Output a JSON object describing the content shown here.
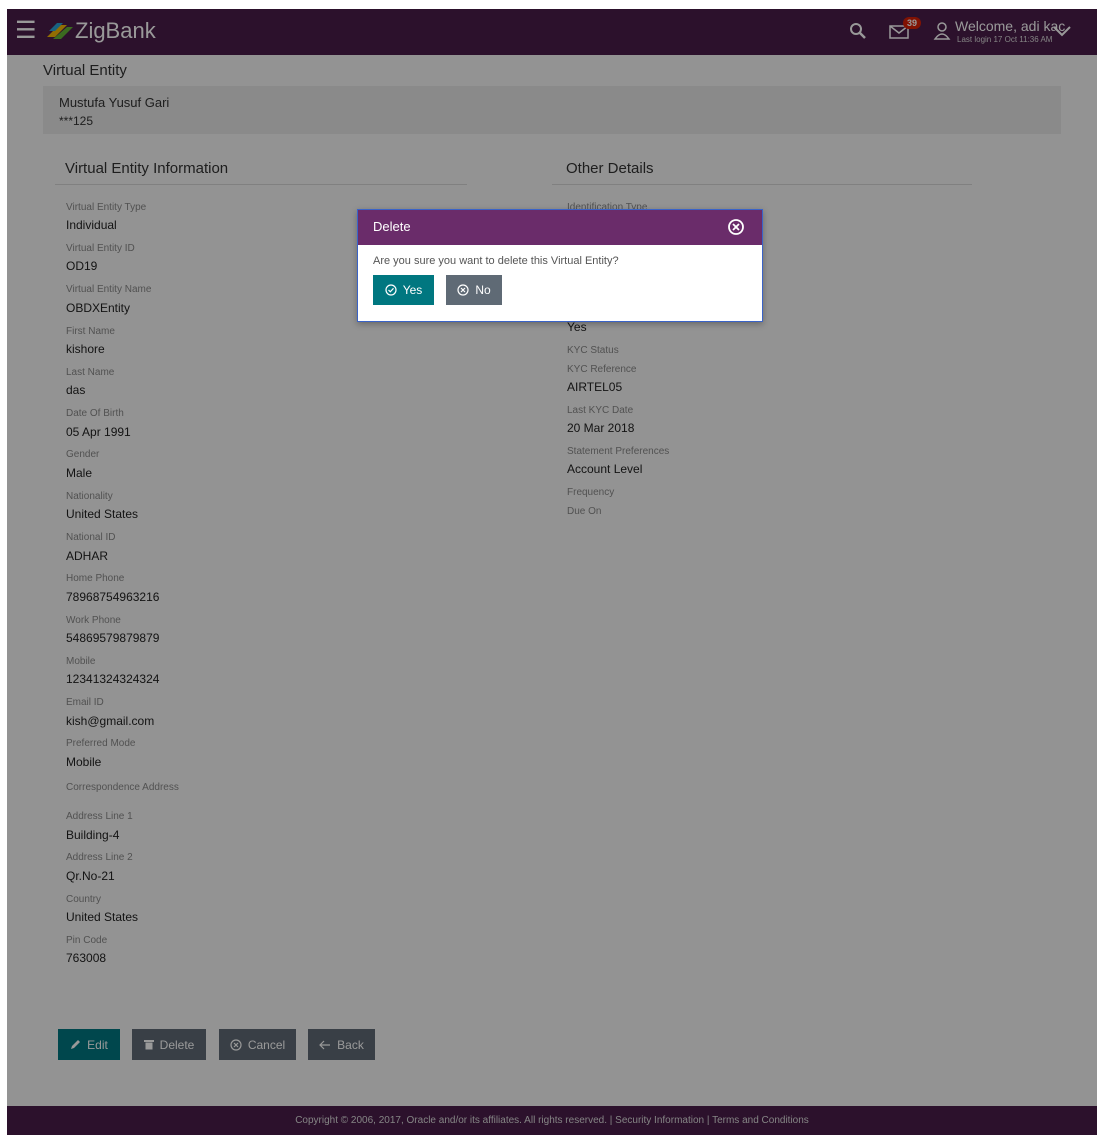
{
  "header": {
    "brand": "ZigBank",
    "notification_count": "39",
    "welcome": "Welcome, adi kac",
    "last_login": "Last login 17 Oct 11:36 AM"
  },
  "page": {
    "title": "Virtual Entity"
  },
  "party": {
    "name": "Mustufa Yusuf Gari",
    "id": "***125"
  },
  "left_section": {
    "title": "Virtual Entity Information",
    "fields": [
      {
        "label": "Virtual Entity Type",
        "value": "Individual"
      },
      {
        "label": "Virtual Entity ID",
        "value": "OD19"
      },
      {
        "label": "Virtual Entity Name",
        "value": "OBDXEntity"
      },
      {
        "label": "First Name",
        "value": "kishore"
      },
      {
        "label": "Last Name",
        "value": "das"
      },
      {
        "label": "Date Of Birth",
        "value": "05 Apr 1991"
      },
      {
        "label": "Gender",
        "value": "Male"
      },
      {
        "label": "Nationality",
        "value": "United States"
      },
      {
        "label": "National ID",
        "value": "ADHAR"
      },
      {
        "label": "Home Phone",
        "value": "78968754963216"
      },
      {
        "label": "Work Phone",
        "value": "54869579879879"
      },
      {
        "label": "Mobile",
        "value": "12341324324324"
      },
      {
        "label": "Email ID",
        "value": "kish@gmail.com"
      },
      {
        "label": "Preferred Mode",
        "value": "Mobile"
      }
    ],
    "address_heading": "Correspondence Address",
    "address_fields": [
      {
        "label": "Address Line 1",
        "value": "Building-4"
      },
      {
        "label": "Address Line 2",
        "value": "Qr.No-21"
      },
      {
        "label": "Country",
        "value": "United States"
      },
      {
        "label": "Pin Code",
        "value": "763008"
      }
    ]
  },
  "right_section": {
    "title": "Other Details",
    "partial_label": "Identification Type",
    "partial_value": "Yes",
    "fields": [
      {
        "label": "KYC Status",
        "value": ""
      },
      {
        "label": "KYC Reference",
        "value": "AIRTEL05"
      },
      {
        "label": "Last KYC Date",
        "value": "20 Mar 2018"
      },
      {
        "label": "Statement Preferences",
        "value": "Account Level"
      },
      {
        "label": "Frequency",
        "value": ""
      },
      {
        "label": "Due On",
        "value": ""
      }
    ]
  },
  "actions": {
    "edit": "Edit",
    "delete": "Delete",
    "cancel": "Cancel",
    "back": "Back"
  },
  "footer": {
    "copyright": "Copyright © 2006, 2017, Oracle and/or its affiliates. All rights reserved. | ",
    "security": "Security Information",
    "sep": " | ",
    "terms": "Terms and Conditions"
  },
  "modal": {
    "title": "Delete",
    "message": "Are you sure you want to delete this Virtual Entity?",
    "yes": "Yes",
    "no": "No"
  },
  "colors": {
    "header_bg": "#4a1d4a",
    "modal_header_bg": "#6a2c6a",
    "primary_button": "#007780",
    "secondary_button": "#5f6a75",
    "badge": "#d81e05"
  },
  "icons": {
    "menu": "hamburger-icon",
    "search": "search-icon",
    "mail": "mail-icon",
    "user": "user-icon",
    "dropdown": "chevron-down-icon",
    "close": "close-circle-icon"
  }
}
